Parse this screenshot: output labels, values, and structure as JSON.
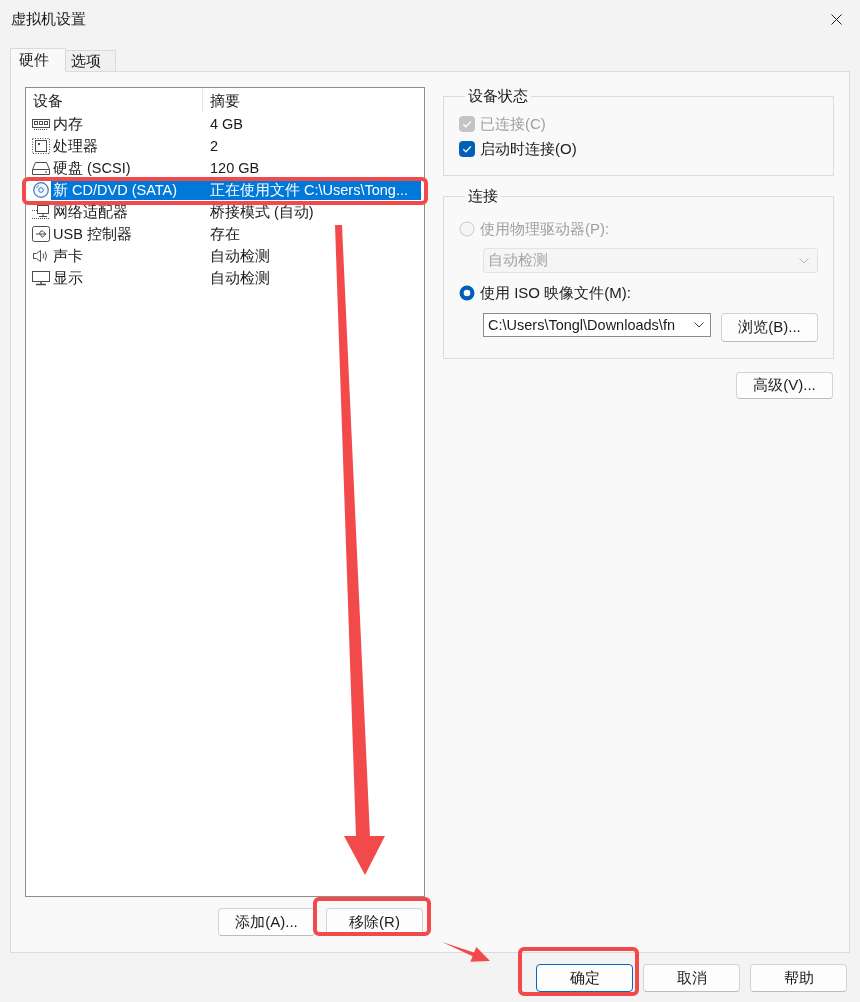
{
  "window": {
    "title": "虚拟机设置"
  },
  "tabs": [
    {
      "label": "硬件",
      "selected": true
    },
    {
      "label": "选项",
      "selected": false
    }
  ],
  "device_list": {
    "columns": [
      "设备",
      "摘要"
    ],
    "rows": [
      {
        "kind": "memory",
        "device": "内存",
        "summary": "4 GB",
        "selected": false,
        "highlighted": false
      },
      {
        "kind": "processor",
        "device": "处理器",
        "summary": "2",
        "selected": false,
        "highlighted": false
      },
      {
        "kind": "disk",
        "device": "硬盘 (SCSI)",
        "summary": "120 GB",
        "selected": false,
        "highlighted": false
      },
      {
        "kind": "cdrom",
        "device": "新 CD/DVD (SATA)",
        "summary": "正在使用文件 C:\\Users\\Tong...",
        "selected": true,
        "highlighted": true
      },
      {
        "kind": "network",
        "device": "网络适配器",
        "summary": "桥接模式 (自动)",
        "selected": false,
        "highlighted": false
      },
      {
        "kind": "usb",
        "device": "USB 控制器",
        "summary": "存在",
        "selected": false,
        "highlighted": false
      },
      {
        "kind": "sound",
        "device": "声卡",
        "summary": "自动检测",
        "selected": false,
        "highlighted": false
      },
      {
        "kind": "display",
        "device": "显示",
        "summary": "自动检测",
        "selected": false,
        "highlighted": false
      }
    ]
  },
  "list_buttons": [
    {
      "label": "添加(A)...",
      "highlighted": false
    },
    {
      "label": "移除(R)",
      "highlighted": true
    }
  ],
  "device_status": {
    "title": "设备状态",
    "checkboxes": [
      {
        "label": "已连接(C)",
        "checked": true,
        "disabled": true
      },
      {
        "label": "启动时连接(O)",
        "checked": true,
        "disabled": false
      }
    ]
  },
  "connection": {
    "title": "连接",
    "options": [
      {
        "kind": "drive",
        "label": "使用物理驱动器(P):",
        "selected": false,
        "disabled": true,
        "dropdown": {
          "value": "自动检测",
          "disabled": true
        }
      },
      {
        "kind": "image",
        "label": "使用 ISO 映像文件(M):",
        "selected": true,
        "disabled": false,
        "path": {
          "value": "C:\\Users\\Tongl\\Downloads\\fn"
        },
        "browse_button": "浏览(B)..."
      }
    ]
  },
  "advanced_button": "高级(V)...",
  "dialog_buttons": [
    {
      "label": "确定",
      "default": true,
      "highlighted": true
    },
    {
      "label": "取消",
      "default": false,
      "highlighted": false
    },
    {
      "label": "帮助",
      "default": false,
      "highlighted": false
    }
  ]
}
